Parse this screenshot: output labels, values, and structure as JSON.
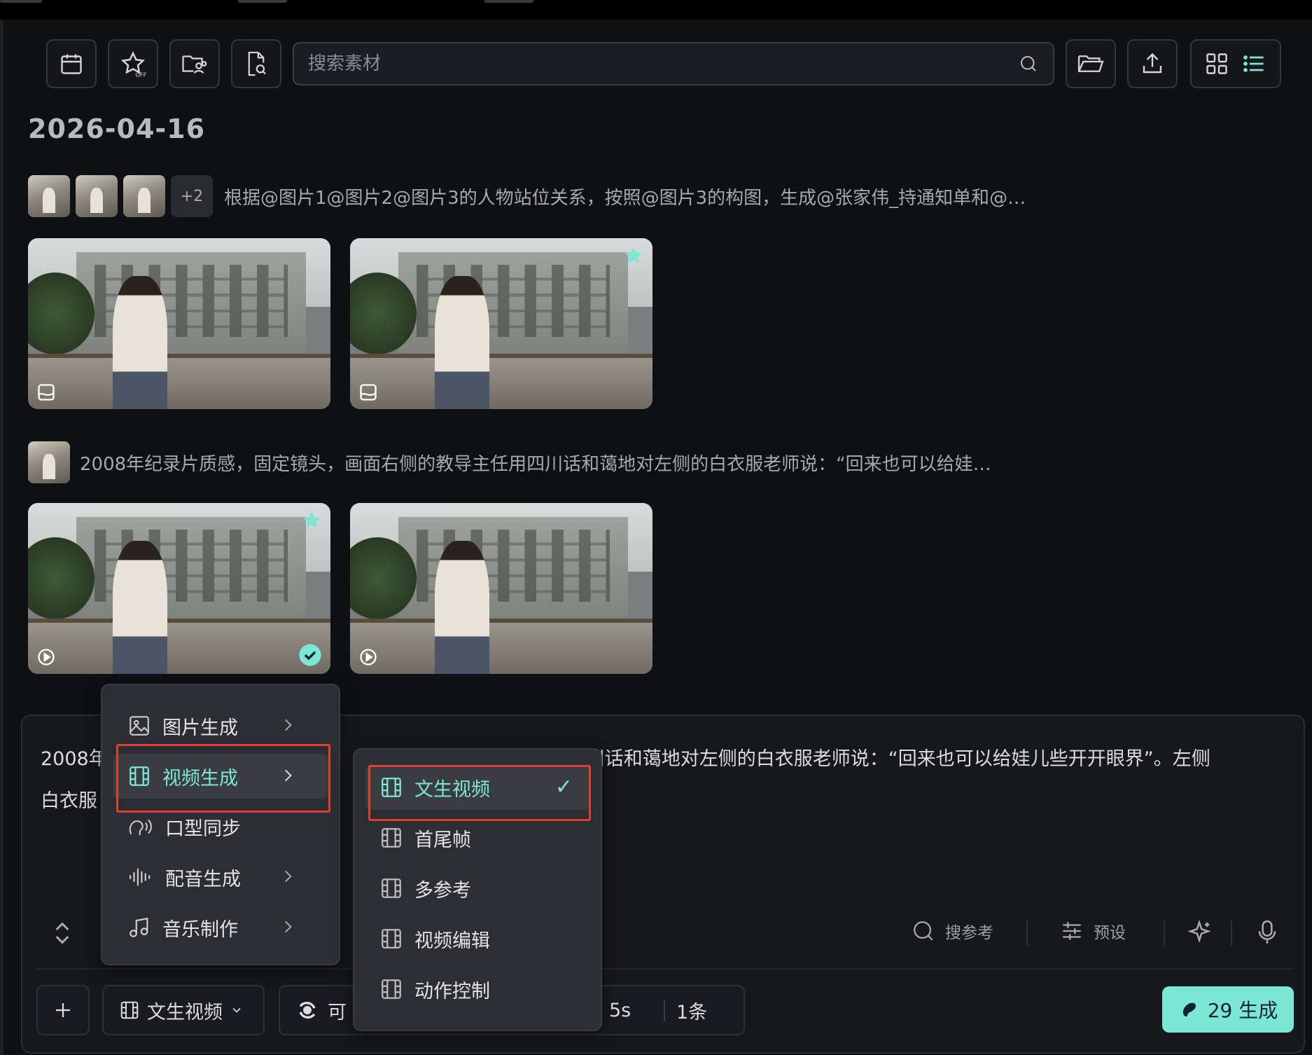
{
  "toolbar": {
    "search_placeholder": "搜索素材",
    "icons": [
      "calendar-icon",
      "star-off-icon",
      "shared-folder-icon",
      "file-search-icon",
      "folder-open-icon",
      "upload-icon",
      "grid-view-icon",
      "list-view-icon"
    ],
    "star_off_label": "OFF"
  },
  "date_header": "2026-04-16",
  "groups": [
    {
      "prompt": "根据@图片1@图片2@图片3的人物站位关系，按照@图片3的构图，生成@张家伟_持通知单和@…",
      "extra_count": "+2",
      "kind": "image"
    },
    {
      "prompt": "2008年纪录片质感，固定镜头，画面右侧的教导主任用四川话和蔼地对左侧的白衣服老师说：“回来也可以给娃…",
      "kind": "video"
    }
  ],
  "composer": {
    "line1_start": "2008年",
    "line1_end": "画面右侧的教导主任用四川话和蔼地对左侧的白衣服老师说：“回来也可以给娃儿些开开眼界”。左侧",
    "line2_start": "白衣服",
    "tools": {
      "search_ref": "搜参考",
      "preset": "预设"
    },
    "bottom": {
      "mode_label": "文生视频",
      "model_label_partial": "可",
      "duration": "5s",
      "count": "1条",
      "generate_label": "29 生成"
    }
  },
  "menu_main": {
    "items": [
      {
        "label": "图片生成",
        "icon": "image-icon",
        "has_submenu": true
      },
      {
        "label": "视频生成",
        "icon": "film-icon",
        "has_submenu": true,
        "active": true
      },
      {
        "label": "口型同步",
        "icon": "lip-sync-icon",
        "has_submenu": false
      },
      {
        "label": "配音生成",
        "icon": "waveform-icon",
        "has_submenu": true
      },
      {
        "label": "音乐制作",
        "icon": "music-note-icon",
        "has_submenu": true
      }
    ]
  },
  "menu_sub": {
    "items": [
      {
        "label": "文生视频",
        "selected": true
      },
      {
        "label": "首尾帧"
      },
      {
        "label": "多参考"
      },
      {
        "label": "视频编辑"
      },
      {
        "label": "动作控制"
      }
    ],
    "check": "✓"
  },
  "colors": {
    "accent": "#7be8d6",
    "highlight_border": "#e0402e",
    "background": "#0f1014"
  }
}
